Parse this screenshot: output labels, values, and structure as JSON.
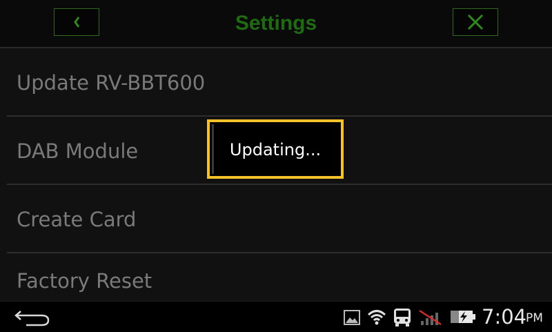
{
  "header": {
    "title": "Settings",
    "back_icon": "chevron-left-icon",
    "close_icon": "close-icon",
    "accent_color": "#1e6b12"
  },
  "settings_list": {
    "items": [
      {
        "label": "Update RV-BBT600"
      },
      {
        "label": "DAB Module"
      },
      {
        "label": "Create Card"
      },
      {
        "label": "Factory Reset"
      }
    ]
  },
  "popup": {
    "message": "Updating...",
    "border_color": "#f5c22a"
  },
  "statusbar": {
    "back_icon": "android-back-icon",
    "icons": [
      "image-notification-icon",
      "wifi-icon",
      "bus-icon",
      "no-signal-icon",
      "battery-charging-icon"
    ],
    "time": "7:04",
    "ampm": "PM"
  }
}
